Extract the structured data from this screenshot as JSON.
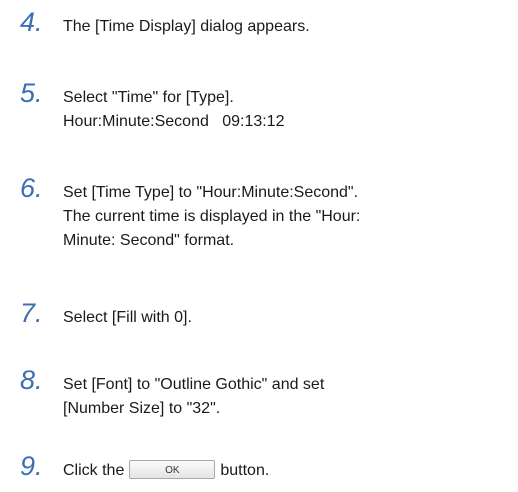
{
  "steps": [
    {
      "number": "4.",
      "lines": [
        "The [Time Display] dialog appears."
      ]
    },
    {
      "number": "5.",
      "lines": [
        "Select \"Time\" for [Type].",
        "Hour:Minute:Second   09:13:12"
      ]
    },
    {
      "number": "6.",
      "lines": [
        "Set [Time Type] to \"Hour:Minute:Second\".",
        "The current time is displayed in the \"Hour:",
        "Minute: Second\" format."
      ]
    },
    {
      "number": "7.",
      "lines": [
        "Select [Fill with 0]."
      ]
    },
    {
      "number": "8.",
      "lines": [
        "Set [Font] to \"Outline Gothic\" and set",
        "[Number Size] to \"32\"."
      ]
    },
    {
      "number": "9.",
      "before_button": "Click the",
      "button_label": "OK",
      "after_button": "button."
    }
  ]
}
